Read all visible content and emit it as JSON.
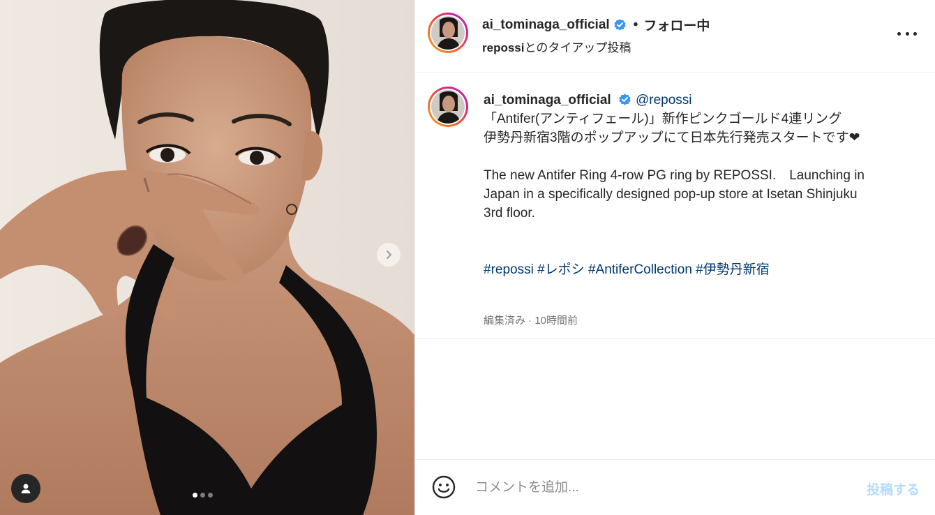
{
  "post": {
    "author": "ai_tominaga_official",
    "follow_state": "フォロー中",
    "separator": "•",
    "partner": "repossi",
    "partner_suffix": "とのタイアップ投稿",
    "carousel": {
      "count": 3,
      "active_index": 0
    }
  },
  "caption": {
    "author": "ai_tominaga_official",
    "mention": "@repossi",
    "lines_jp": [
      "「Antifer(アンティフェール)」新作ピンクゴールド4連リング",
      "伊勢丹新宿3階のポップアップにて日本先行発売スタートです❤"
    ],
    "lines_en": [
      "The new Antifer Ring 4-row PG ring by REPOSSI.　Launching in",
      "Japan in a specifically designed pop-up store at Isetan Shinjuku",
      "3rd floor."
    ],
    "hashtags": [
      "#repossi",
      "#レポシ",
      "#AntiferCollection",
      "#伊勢丹新宿"
    ],
    "meta": "編集済み · 10時間前"
  },
  "comment": {
    "placeholder": "コメントを追加...",
    "post_label": "投稿する"
  },
  "colors": {
    "link": "#00376b",
    "verified": "#3897f0",
    "post_disabled": "#b3dbff",
    "text": "#262626",
    "meta": "#737373"
  },
  "icons": {
    "verified": "verified-badge-icon",
    "more": "more-options-icon",
    "next": "chevron-right-icon",
    "tag": "user-tag-icon",
    "emoji": "emoji-icon"
  }
}
